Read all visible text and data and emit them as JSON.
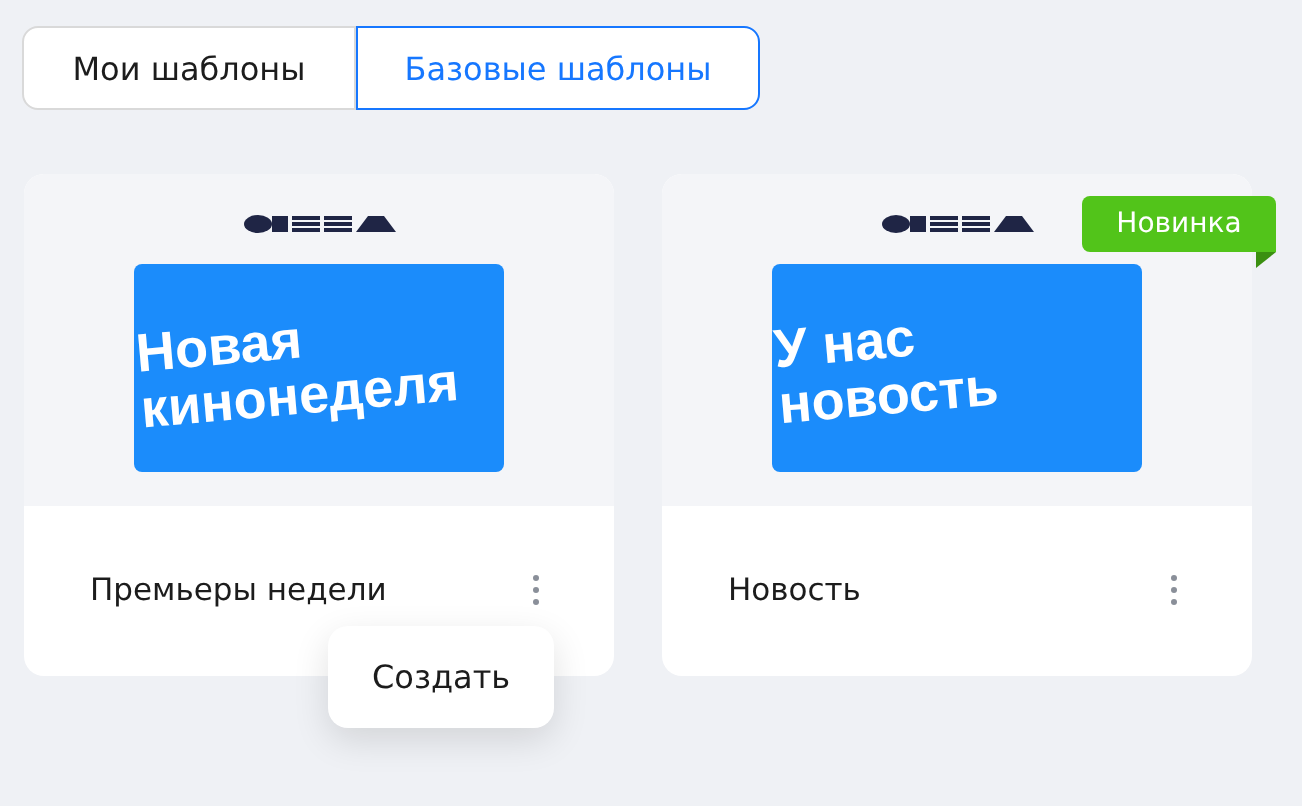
{
  "tabs": [
    {
      "label": "Мои шаблоны",
      "selected": false
    },
    {
      "label": "Базовые шаблоны",
      "selected": true
    }
  ],
  "cards": [
    {
      "title": "Премьеры недели",
      "preview_lines": [
        "Новая",
        "кинонеделя"
      ],
      "menu": {
        "items": [
          "Создать"
        ]
      }
    },
    {
      "title": "Новость",
      "preview_lines": [
        "У нас",
        "новость"
      ],
      "badge": "Новинка"
    }
  ]
}
